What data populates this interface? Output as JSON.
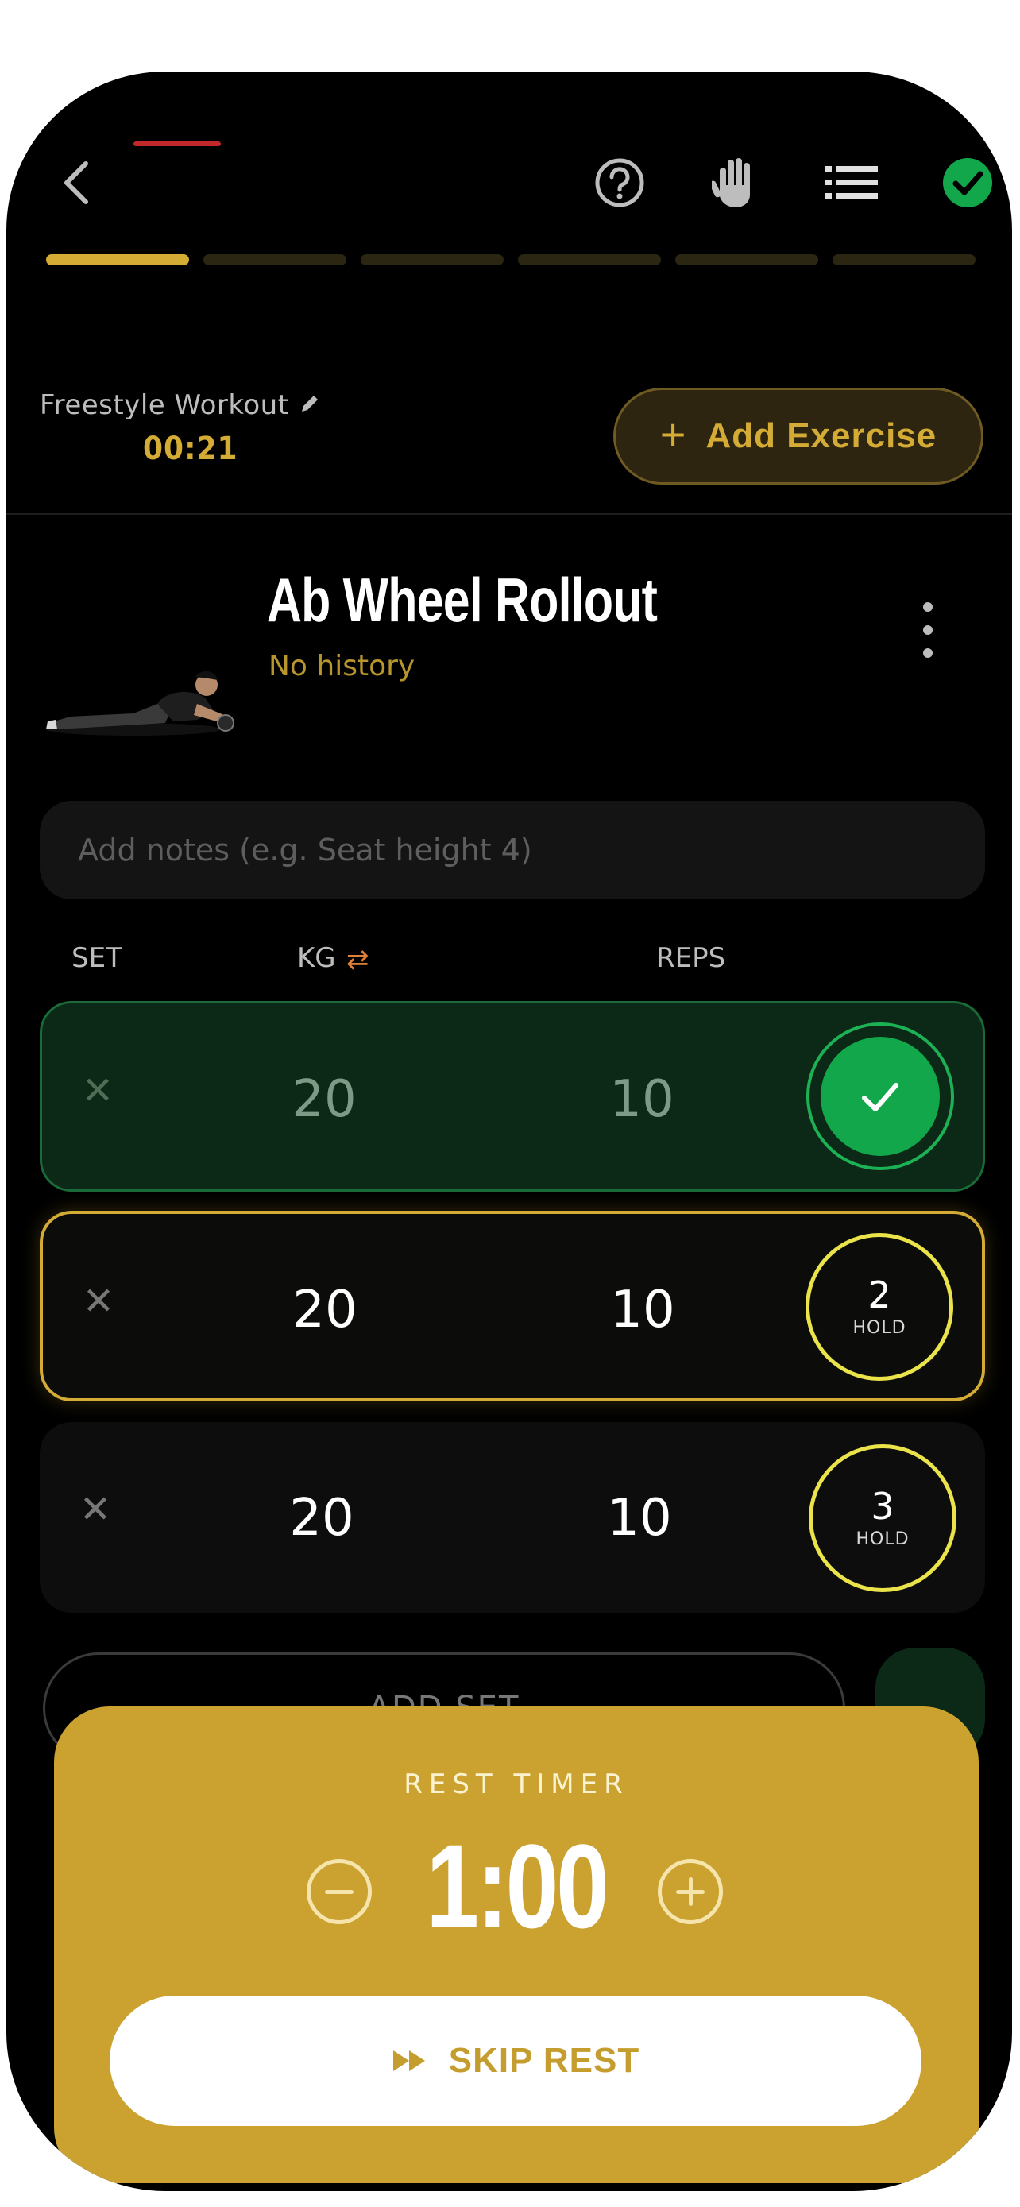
{
  "header": {
    "workout_name": "Freestyle Workout",
    "elapsed": "00:21",
    "add_exercise_label": "Add Exercise",
    "progress_segments": 6,
    "progress_active_index": 0
  },
  "exercise": {
    "title": "Ab Wheel Rollout",
    "history": "No history"
  },
  "notes": {
    "placeholder": "Add notes (e.g. Seat height 4)"
  },
  "columns": {
    "set": "SET",
    "kg": "KG",
    "reps": "REPS"
  },
  "sets": [
    {
      "kg": "20",
      "reps": "10",
      "status": "done"
    },
    {
      "kg": "20",
      "reps": "10",
      "status": "current",
      "number": "2",
      "label": "HOLD"
    },
    {
      "kg": "20",
      "reps": "10",
      "status": "pending",
      "number": "3",
      "label": "HOLD"
    }
  ],
  "add_set_label": "ADD SET",
  "rest_timer": {
    "label": "REST TIMER",
    "time": "1:00",
    "skip_label": "SKIP REST"
  },
  "colors": {
    "accent": "#d3ab35",
    "success": "#12a74b",
    "hold_ring": "#ebe34a",
    "background": "#000000"
  }
}
